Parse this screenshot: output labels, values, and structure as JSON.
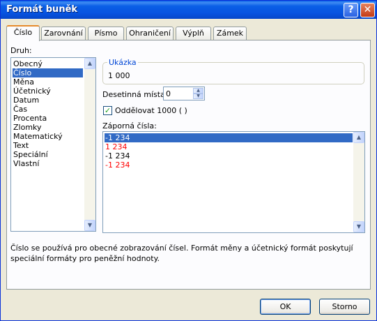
{
  "window": {
    "title": "Formát buněk",
    "help_label": "?",
    "close_label": "✕"
  },
  "tabs": [
    {
      "label": "Číslo",
      "active": true
    },
    {
      "label": "Zarovnání"
    },
    {
      "label": "Písmo"
    },
    {
      "label": "Ohraničení"
    },
    {
      "label": "Výplň"
    },
    {
      "label": "Zámek"
    }
  ],
  "category": {
    "label": "Druh:",
    "items": [
      "Obecný",
      "Číslo",
      "Měna",
      "Účetnický",
      "Datum",
      "Čas",
      "Procenta",
      "Zlomky",
      "Matematický",
      "Text",
      "Speciální",
      "Vlastní"
    ],
    "selected": "Číslo"
  },
  "sample": {
    "title": "Ukázka",
    "value": "1 000"
  },
  "decimals": {
    "label": "Desetinná místa:",
    "value": "0"
  },
  "separator": {
    "label": "Oddělovat 1000 ( )",
    "checked": true
  },
  "negative": {
    "label": "Záporná čísla:",
    "items": [
      {
        "text": "-1 234",
        "color": "#ffffff",
        "selected": true
      },
      {
        "text": "1 234",
        "color": "#ff0000"
      },
      {
        "text": "-1 234",
        "color": "#000000"
      },
      {
        "text": "-1 234",
        "color": "#ff0000"
      }
    ]
  },
  "description": "Číslo se používá pro obecné zobrazování čísel. Formát měny a účetnický formát poskytují speciální formáty pro peněžní hodnoty.",
  "buttons": {
    "ok": "OK",
    "cancel": "Storno"
  },
  "colors": {
    "titlebar": "#0a5fe6",
    "selection": "#316ac5",
    "group_title": "#0046d5",
    "tab_accent": "#e68b2c"
  }
}
